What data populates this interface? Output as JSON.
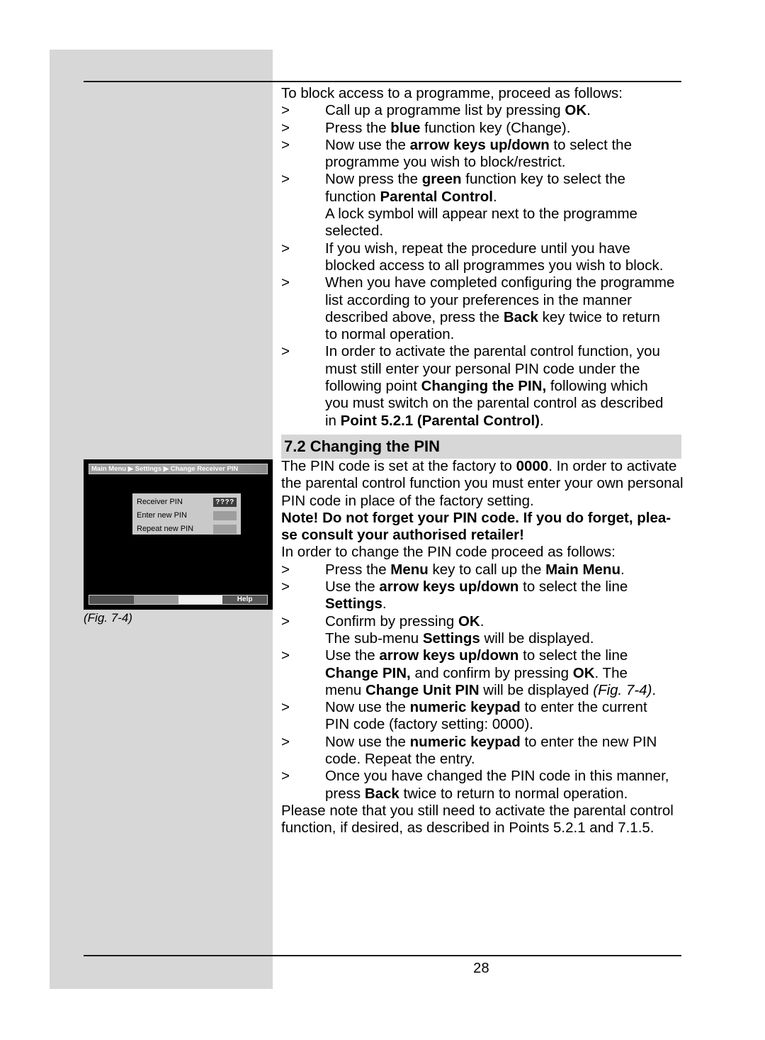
{
  "page": {
    "number": "28"
  },
  "intro": {
    "lead": "To block access to a programme, proceed as follows:",
    "bullet_mark": ">"
  },
  "steps_block_programme": [
    {
      "mark": ">",
      "lines": [
        "Call up a programme list by pressing <b>OK</b>."
      ]
    },
    {
      "mark": ">",
      "lines": [
        "Press the <b>blue</b> function key (Change)."
      ]
    },
    {
      "mark": ">",
      "lines": [
        "Now use the <b>arrow keys up/down</b> to select the",
        "programme you wish to block/restrict."
      ]
    },
    {
      "mark": ">",
      "lines": [
        "Now press the <b>green</b> function key to select the",
        "function <b>Parental Control</b>.",
        "A lock symbol will appear next to the programme",
        "selected."
      ]
    },
    {
      "mark": ">",
      "lines": [
        "If you wish, repeat the procedure until you have",
        "blocked access to all programmes you wish to block."
      ]
    },
    {
      "mark": ">",
      "lines": [
        "When you have completed configuring the programme",
        "list according to your preferences in the manner",
        "described above, press the <b>Back</b> key twice to return",
        "to normal operation."
      ]
    },
    {
      "mark": ">",
      "lines": [
        "In order to activate the parental control function, you",
        "must still enter your personal PIN code under the",
        "following point <b>Changing the PIN,</b> following which",
        "you must switch on the parental control as described",
        "in <b>Point 5.2.1 (Parental Control)</b>."
      ]
    }
  ],
  "section": {
    "heading": "7.2 Changing the PIN",
    "paragraph_1": "The PIN code is set at the factory to <b>0000</b>. In order to activate the parental control function you must enter your own personal PIN code in place of the factory setting.",
    "note": "Note! Do not forget your PIN code. If you do forget, please consult your authorised retailer!",
    "paragraph_2": "In order to change the PIN code proceed as follows:",
    "closing": "Please note that you still need to activate the parental control function, if desired, as described in Points 5.2.1 and 7.1.5."
  },
  "steps_change_pin": [
    {
      "mark": ">",
      "lines": [
        "Press the <b>Menu</b> key to call up the <b>Main Menu</b>."
      ]
    },
    {
      "mark": ">",
      "lines": [
        "Use the <b>arrow keys up/down</b> to select the line",
        "<b>Settings</b>."
      ]
    },
    {
      "mark": ">",
      "lines": [
        "Confirm by pressing <b>OK</b>.",
        "The sub-menu <b>Settings</b> will be displayed."
      ]
    },
    {
      "mark": ">",
      "lines": [
        "Use the <b>arrow keys up/down</b> to select the line",
        "<b>Change PIN,</b> and confirm by pressing <b>OK</b>. The",
        "menu <b>Change Unit PIN</b> will be displayed <i>(Fig. 7-4)</i>."
      ]
    },
    {
      "mark": ">",
      "lines": [
        "Now use the <b>numeric keypad</b> to enter the current",
        "PIN code (factory setting: 0000)."
      ]
    },
    {
      "mark": ">",
      "lines": [
        "Now use the <b>numeric keypad</b> to enter the new PIN",
        "code. Repeat the entry."
      ]
    },
    {
      "mark": ">",
      "lines": [
        "Once you have changed the PIN code in this manner,",
        "press <b>Back</b> twice to return to normal operation."
      ]
    }
  ],
  "figure": {
    "caption": "(Fig. 7-4)",
    "breadcrumb": "Main Menu ▶ Settings ▶ Change Receiver PIN",
    "rows": [
      {
        "label": "Receiver PIN",
        "value": "????",
        "active": true
      },
      {
        "label": "Enter new PIN",
        "value": "",
        "active": false
      },
      {
        "label": "Repeat new PIN",
        "value": "",
        "active": false
      }
    ],
    "colorbar": {
      "segment_1": "",
      "segment_2": "",
      "segment_3": "",
      "help_label": "Help"
    }
  },
  "colors": {
    "sidebar_gray": "#d7d7d7",
    "heading_gray": "#d7d7d7",
    "rule_black": "#1a1a1a",
    "osd_background": "#000000",
    "osd_panel_gray": "#c9c9c9",
    "osd_field_gray": "#9e9e9e",
    "osd_field_active": "#3c3c3c"
  }
}
